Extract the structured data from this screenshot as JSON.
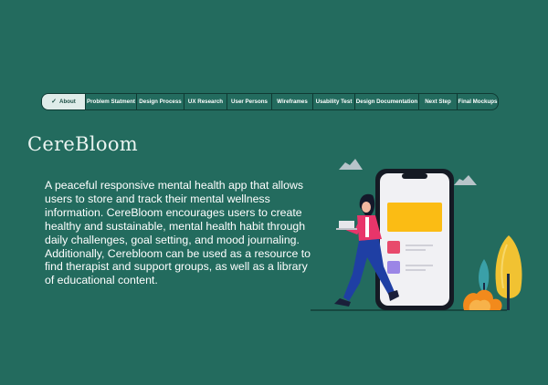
{
  "nav": {
    "tabs": [
      {
        "label": "About",
        "active": true
      },
      {
        "label": "Problem Statment",
        "active": false
      },
      {
        "label": "Design Process",
        "active": false
      },
      {
        "label": "UX Research",
        "active": false
      },
      {
        "label": "User Persons",
        "active": false
      },
      {
        "label": "Wireframes",
        "active": false
      },
      {
        "label": "Usability Test",
        "active": false
      },
      {
        "label": "Design Documentation",
        "active": false
      },
      {
        "label": "Next Step",
        "active": false
      },
      {
        "label": "Final Mockups",
        "active": false
      }
    ]
  },
  "hero": {
    "title": "CereBloom",
    "description": "A peaceful responsive mental health app that allows users to store and track their mental wellness information. CereBloom encourages users to create healthy and  sustainable, mental health habit through daily challenges, goal setting, and mood journaling. Additionally, Cerebloom can be used as a resource to find therapist and support groups, as well as a library of educational content."
  },
  "colors": {
    "background": "#236b5e",
    "active_tab": "#dfece9",
    "accent_yellow": "#fbbc14",
    "accent_pink": "#e84a6c",
    "accent_purple": "#9b86e6"
  },
  "illustration": {
    "icons": [
      "cloud-icon",
      "phone-illustration",
      "woman-with-laptop-illustration",
      "tree-icon",
      "bush-icon"
    ]
  }
}
